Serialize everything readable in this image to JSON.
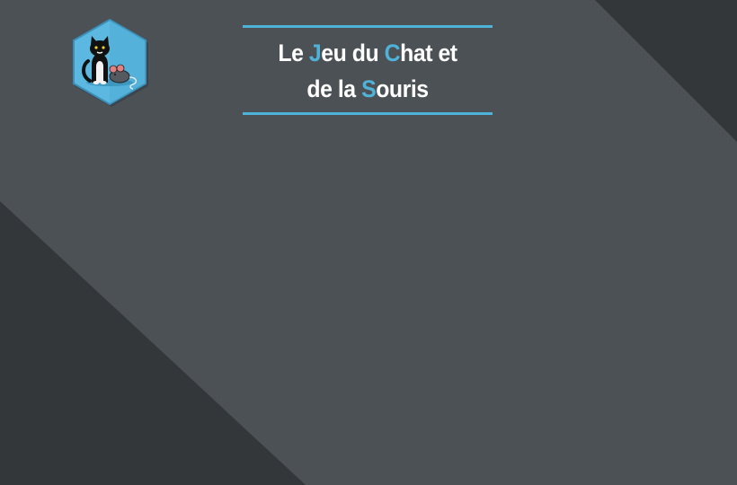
{
  "page": {
    "background_color": "#4c5155",
    "dark_band_color": "#33373a",
    "accent_color": "#4fb3d9"
  },
  "logo": {
    "icon": "cat-and-mouse-icon",
    "hexagon_color": "#5cb8e0"
  },
  "title": {
    "line1": {
      "p1": "Le ",
      "hl1": "J",
      "p2": "eu du ",
      "hl2": "C",
      "p3": "hat et"
    },
    "line2": {
      "p1": "de la ",
      "hl1": "S",
      "p2": "ouris"
    }
  }
}
